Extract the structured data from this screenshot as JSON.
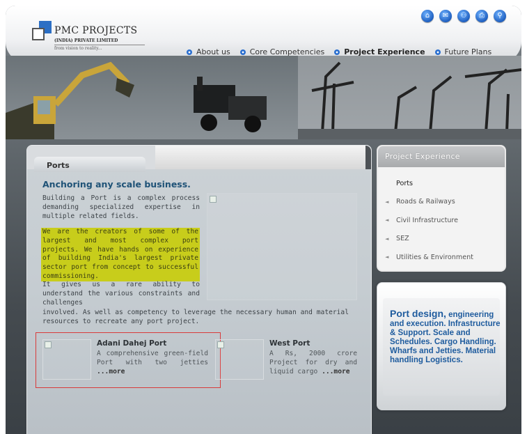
{
  "logo": {
    "title": "PMC PROJECTS",
    "subtitle": "(INDIA) PRIVATE LIMITED",
    "tagline": "from vision to reality..."
  },
  "top_icons": [
    "home-icon",
    "mail-icon",
    "sitemap-icon",
    "print-icon",
    "search-icon"
  ],
  "nav": [
    {
      "label": "About us",
      "active": false
    },
    {
      "label": "Core Competencies",
      "active": false
    },
    {
      "label": "Project Experience",
      "active": true
    },
    {
      "label": "Future Plans",
      "active": false
    }
  ],
  "main": {
    "tab": "Ports",
    "heading": "Anchoring any scale business.",
    "p1": "Building a Port is a complex process demanding specialized expertise in multiple related fields.",
    "p2": "We are the creators of some of the largest and most complex port projects. We have hands on experience of building India's largest private sector port from concept to successful commissioning.",
    "p3": "It gives us a rare ability to understand the various constraints and challenges",
    "p4": "involved. As well as competency to leverage the necessary human and material resources to recreate any port project.",
    "cards": [
      {
        "title": "Adani Dahej Port",
        "desc": "A comprehensive green-field Port with two jetties",
        "more": "...more"
      },
      {
        "title": "West Port",
        "desc": "A Rs, 2000 crore Project for dry and liquid cargo",
        "more": "...more"
      }
    ]
  },
  "sidebar": {
    "heading": "Project Experience",
    "items": [
      {
        "label": "Ports",
        "active": true
      },
      {
        "label": "Roads & Railways",
        "active": false
      },
      {
        "label": "Civil Infrastructure",
        "active": false
      },
      {
        "label": "SEZ",
        "active": false
      },
      {
        "label": "Utilities & Environment",
        "active": false
      }
    ]
  },
  "promo": {
    "lead": "Port design,",
    "text": "engineering and execution. Infrastructure & Support. Scale and Schedules. Cargo Handling. Wharfs and Jetties. Material handling Logistics."
  },
  "colors": {
    "accent_blue": "#1f5277",
    "highlight": "#c8cd1b",
    "promo_blue": "#1f5c9e",
    "selection_red": "#d93a3a"
  }
}
